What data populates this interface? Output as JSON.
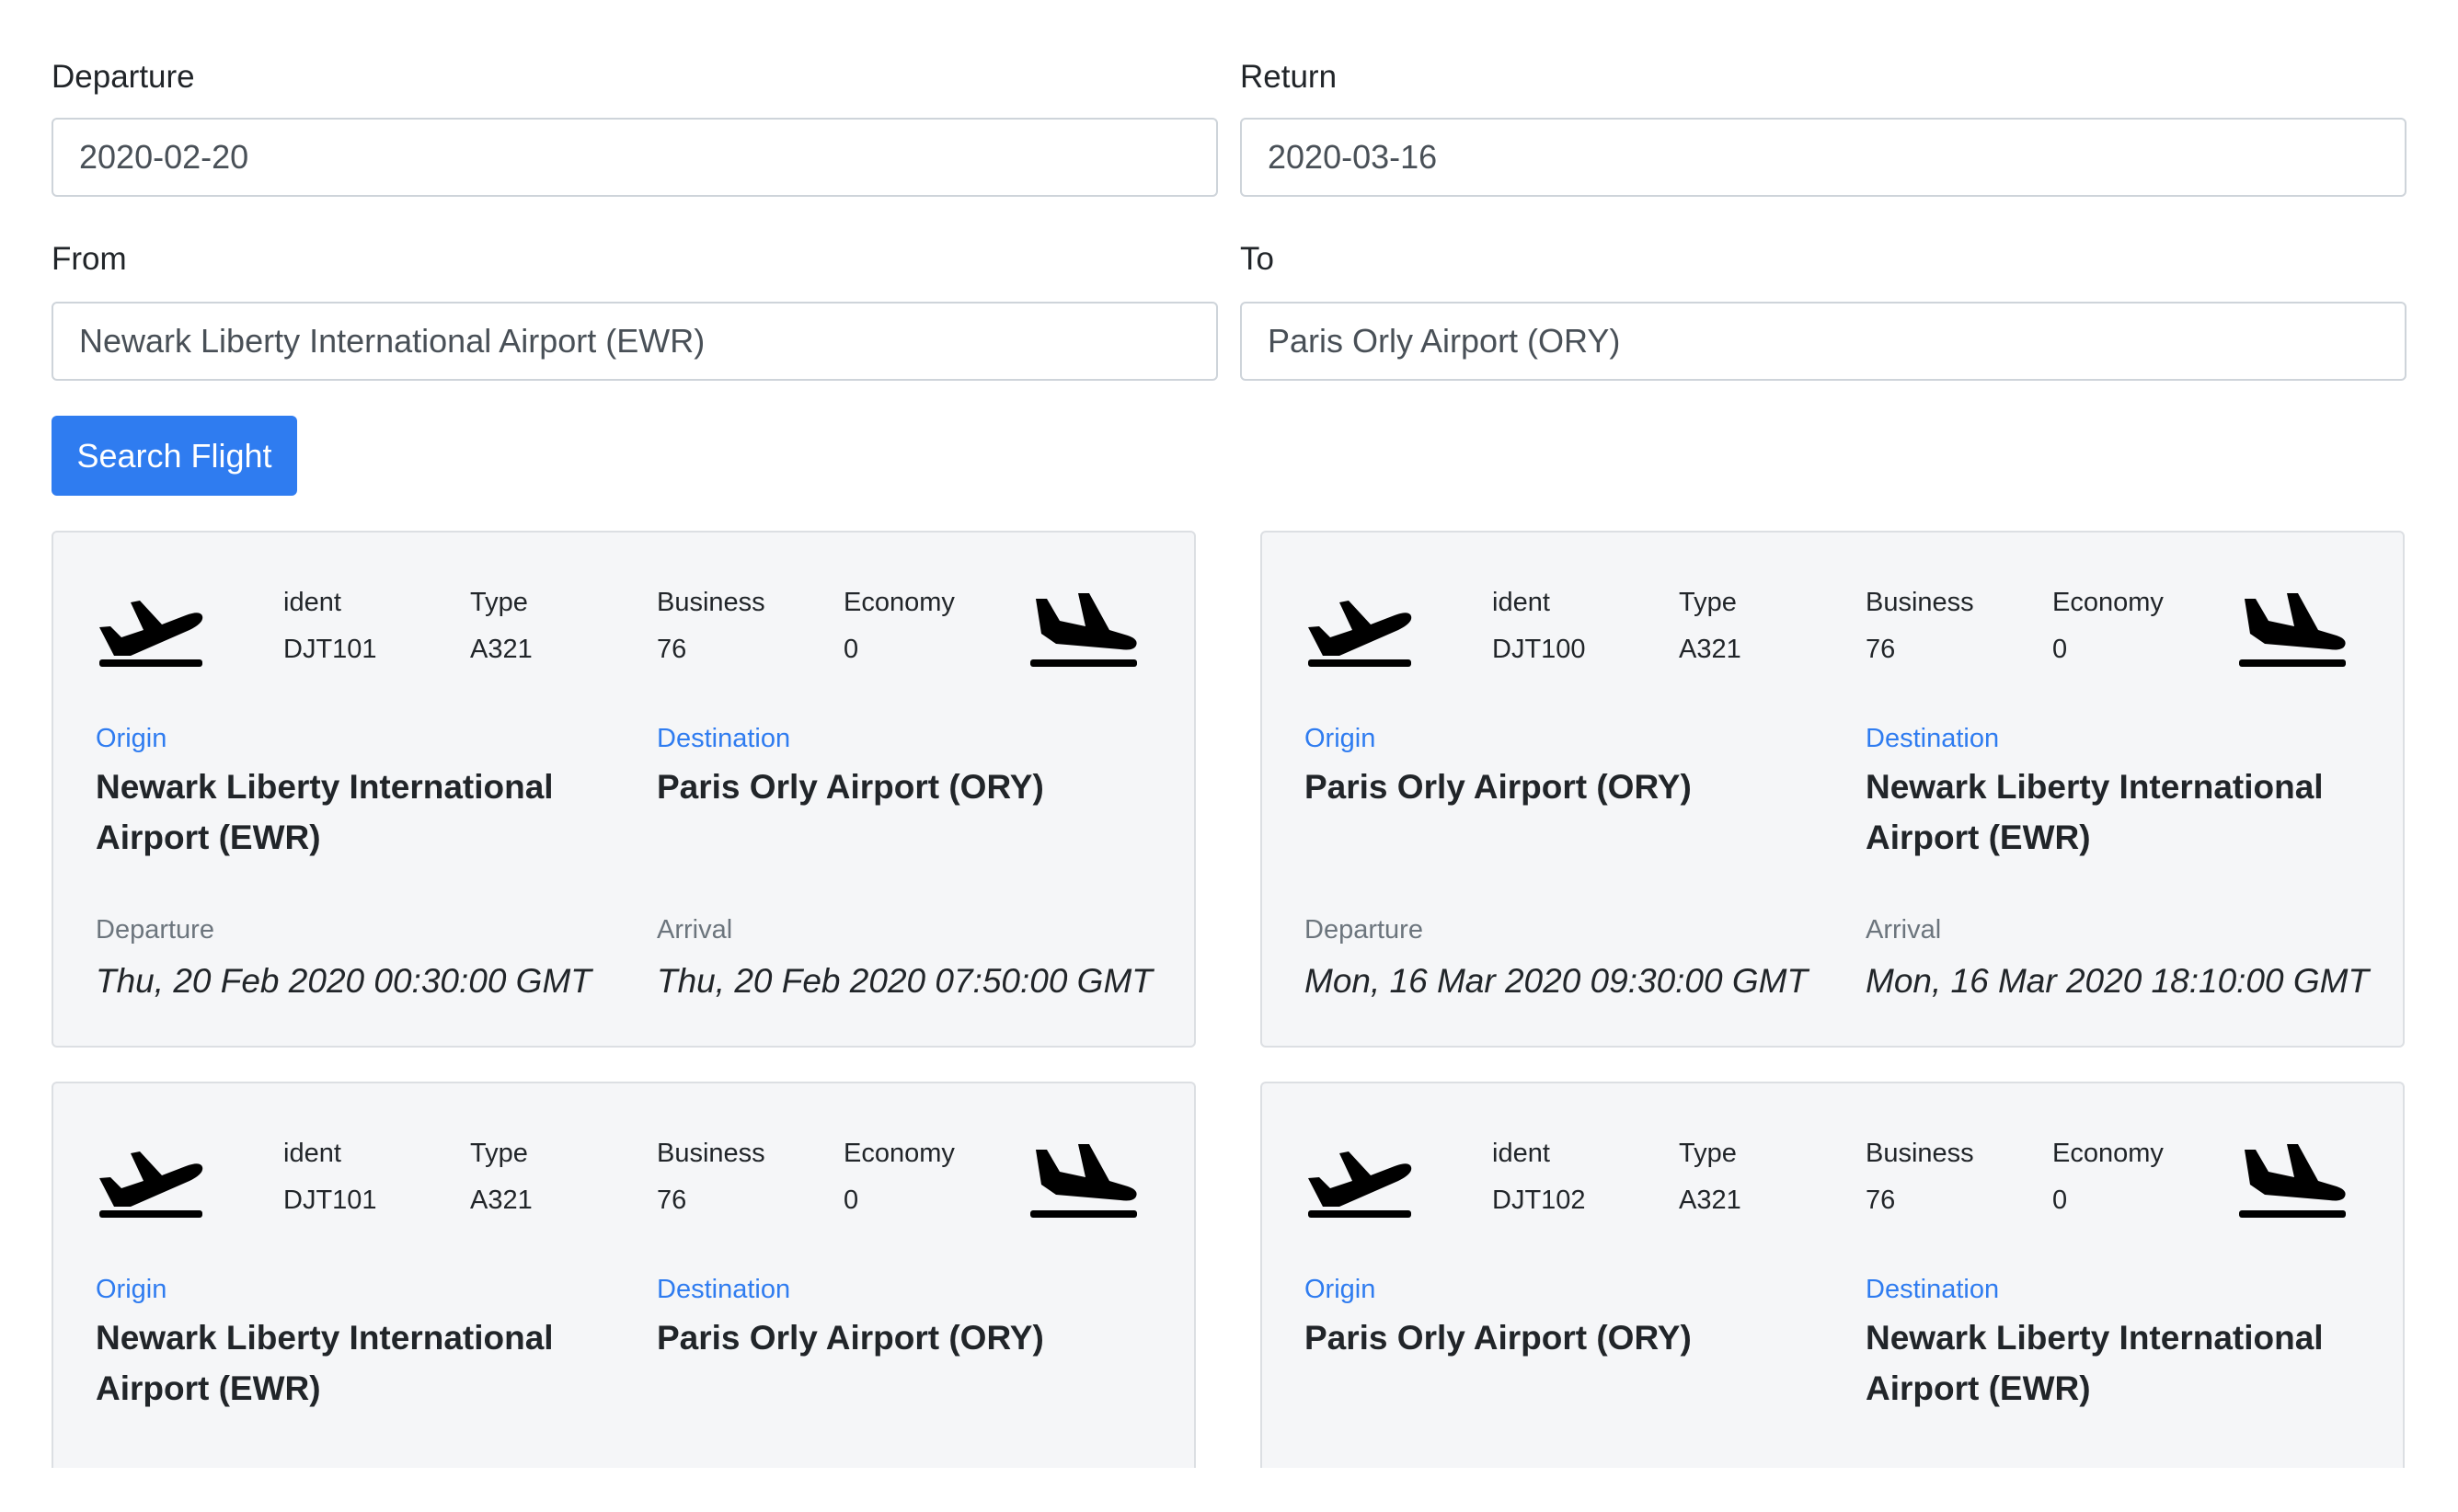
{
  "search": {
    "departure_label": "Departure",
    "departure_value": "2020-02-20",
    "return_label": "Return",
    "return_value": "2020-03-16",
    "from_label": "From",
    "from_value": "Newark Liberty International Airport (EWR)",
    "to_label": "To",
    "to_value": "Paris Orly Airport (ORY)",
    "button_label": "Search Flight"
  },
  "labels": {
    "ident": "ident",
    "type": "Type",
    "business": "Business",
    "economy": "Economy",
    "origin": "Origin",
    "destination": "Destination",
    "departure": "Departure",
    "arrival": "Arrival"
  },
  "icons": {
    "takeoff": "airplane-takeoff-icon",
    "landing": "airplane-landing-icon"
  },
  "flights": [
    {
      "ident": "DJT101",
      "type": "A321",
      "business": "76",
      "economy": "0",
      "origin": "Newark Liberty International Airport (EWR)",
      "destination": "Paris Orly Airport (ORY)",
      "departure": "Thu, 20 Feb 2020 00:30:00 GMT",
      "arrival": "Thu, 20 Feb 2020 07:50:00 GMT"
    },
    {
      "ident": "DJT100",
      "type": "A321",
      "business": "76",
      "economy": "0",
      "origin": "Paris Orly Airport (ORY)",
      "destination": "Newark Liberty International Airport (EWR)",
      "departure": "Mon, 16 Mar 2020 09:30:00 GMT",
      "arrival": "Mon, 16 Mar 2020 18:10:00 GMT"
    },
    {
      "ident": "DJT101",
      "type": "A321",
      "business": "76",
      "economy": "0",
      "origin": "Newark Liberty International Airport (EWR)",
      "destination": "Paris Orly Airport (ORY)"
    },
    {
      "ident": "DJT102",
      "type": "A321",
      "business": "76",
      "economy": "0",
      "origin": "Paris Orly Airport (ORY)",
      "destination": "Newark Liberty International Airport (EWR)"
    }
  ]
}
